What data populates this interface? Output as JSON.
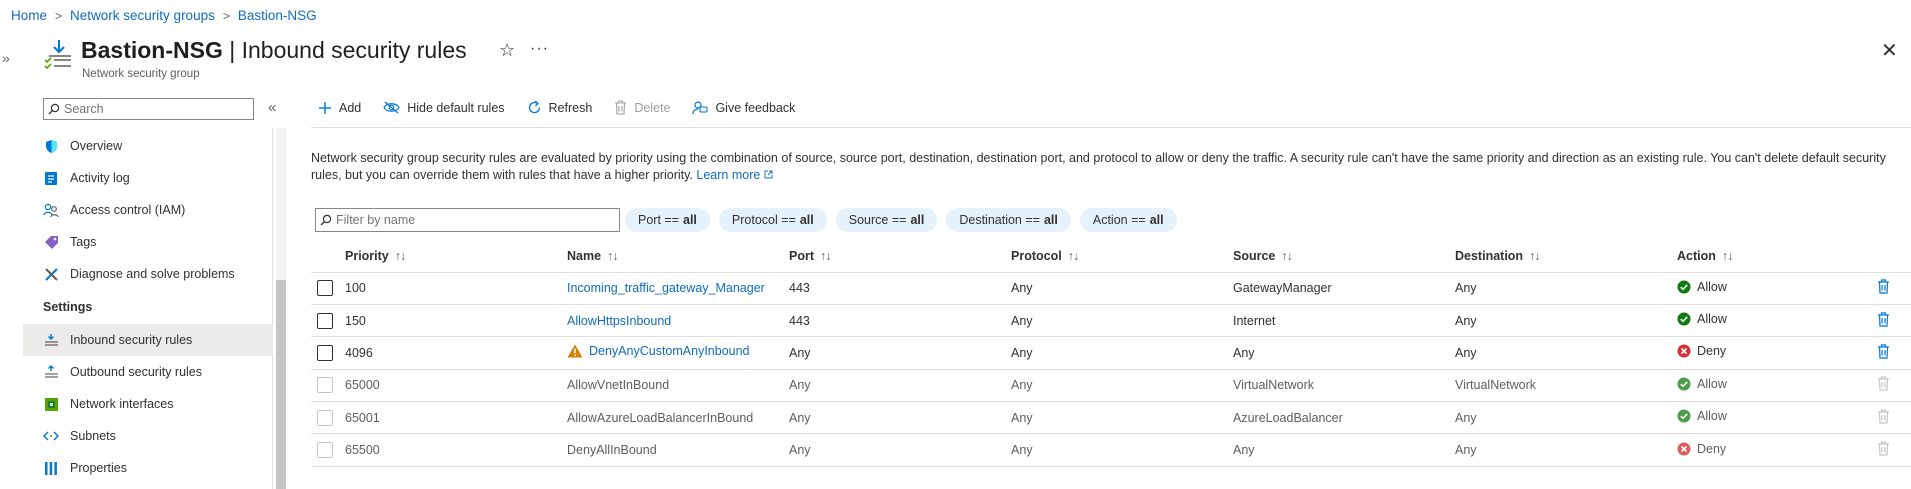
{
  "breadcrumb": {
    "home": "Home",
    "nsg_list": "Network security groups",
    "current": "Bastion-NSG"
  },
  "header": {
    "resource": "Bastion-NSG",
    "divider": " | ",
    "page": "Inbound security rules",
    "subtitle": "Network security group"
  },
  "sidebar": {
    "search_placeholder": "Search",
    "items": [
      {
        "label": "Overview",
        "icon": "shield-icon"
      },
      {
        "label": "Activity log",
        "icon": "activity-log-icon"
      },
      {
        "label": "Access control (IAM)",
        "icon": "people-icon"
      },
      {
        "label": "Tags",
        "icon": "tag-icon"
      },
      {
        "label": "Diagnose and solve problems",
        "icon": "wrench-icon"
      }
    ],
    "section_settings": "Settings",
    "settings_items": [
      {
        "label": "Inbound security rules",
        "icon": "inbound-icon",
        "active": true
      },
      {
        "label": "Outbound security rules",
        "icon": "outbound-icon"
      },
      {
        "label": "Network interfaces",
        "icon": "nic-icon"
      },
      {
        "label": "Subnets",
        "icon": "subnet-icon"
      },
      {
        "label": "Properties",
        "icon": "properties-icon"
      }
    ]
  },
  "toolbar": {
    "add": "Add",
    "hide_default": "Hide default rules",
    "refresh": "Refresh",
    "delete": "Delete",
    "feedback": "Give feedback"
  },
  "description": {
    "text": "Network security group security rules are evaluated by priority using the combination of source, source port, destination, destination port, and protocol to allow or deny the traffic. A security rule can't have the same priority and direction as an existing rule. You can't delete default security rules, but you can override them with rules that have a higher priority.",
    "learn_more": "Learn more"
  },
  "filter": {
    "placeholder": "Filter by name",
    "pills": [
      {
        "label": "Port ==",
        "value": "all"
      },
      {
        "label": "Protocol ==",
        "value": "all"
      },
      {
        "label": "Source ==",
        "value": "all"
      },
      {
        "label": "Destination ==",
        "value": "all"
      },
      {
        "label": "Action ==",
        "value": "all"
      }
    ]
  },
  "table": {
    "columns": [
      "Priority",
      "Name",
      "Port",
      "Protocol",
      "Source",
      "Destination",
      "Action"
    ],
    "sort_glyph": "↑↓",
    "rows": [
      {
        "priority": "100",
        "name": "Incoming_traffic_gateway_Manager",
        "port": "443",
        "protocol": "Any",
        "source": "GatewayManager",
        "destination": "Any",
        "action": "Allow"
      },
      {
        "priority": "150",
        "name": "AllowHttpsInbound",
        "port": "443",
        "protocol": "Any",
        "source": "Internet",
        "destination": "Any",
        "action": "Allow"
      },
      {
        "priority": "4096",
        "name": "DenyAnyCustomAnyInbound",
        "port": "Any",
        "protocol": "Any",
        "source": "Any",
        "destination": "Any",
        "action": "Deny"
      },
      {
        "priority": "65000",
        "name": "AllowVnetInBound",
        "port": "Any",
        "protocol": "Any",
        "source": "VirtualNetwork",
        "destination": "VirtualNetwork",
        "action": "Allow"
      },
      {
        "priority": "65001",
        "name": "AllowAzureLoadBalancerInBound",
        "port": "Any",
        "protocol": "Any",
        "source": "AzureLoadBalancer",
        "destination": "Any",
        "action": "Allow"
      },
      {
        "priority": "65500",
        "name": "DenyAllInBound",
        "port": "Any",
        "protocol": "Any",
        "source": "Any",
        "destination": "Any",
        "action": "Deny"
      }
    ]
  },
  "colors": {
    "link": "#0f6cbd",
    "allow": "#107c10",
    "deny": "#d13438",
    "warning": "#d67f0c"
  }
}
